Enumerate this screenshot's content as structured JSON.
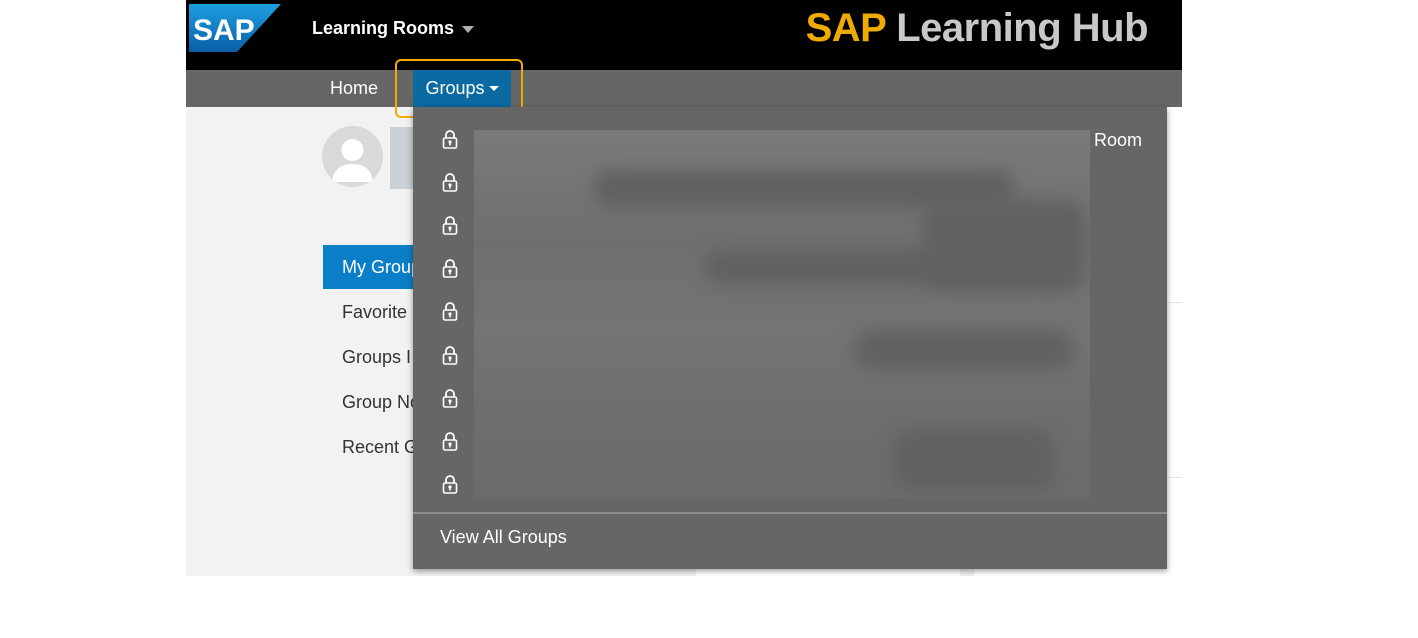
{
  "header": {
    "logo_text": "SAP",
    "room_switch_label": "Learning Rooms",
    "hub_title_brand": "SAP",
    "hub_title_rest": " Learning Hub"
  },
  "nav": {
    "home_label": "Home",
    "groups_label": "Groups"
  },
  "sidebar": {
    "items": [
      {
        "label": "My Groups",
        "active": true
      },
      {
        "label": "Favorite Groups",
        "active": false
      },
      {
        "label": "Groups I Manage",
        "active": false
      },
      {
        "label": "Group Notifications",
        "active": false
      },
      {
        "label": "Recent Groups",
        "active": false
      }
    ]
  },
  "dropdown": {
    "lock_count": 9,
    "partial_text": "Room",
    "view_all_label": "View All Groups"
  },
  "colors": {
    "accent_blue": "#0a6aa1",
    "highlight": "#f0ab00",
    "nav_bg": "#666666"
  },
  "icons": [
    "sap-logo",
    "chevron-down-icon",
    "avatar-icon",
    "lock-icon"
  ]
}
